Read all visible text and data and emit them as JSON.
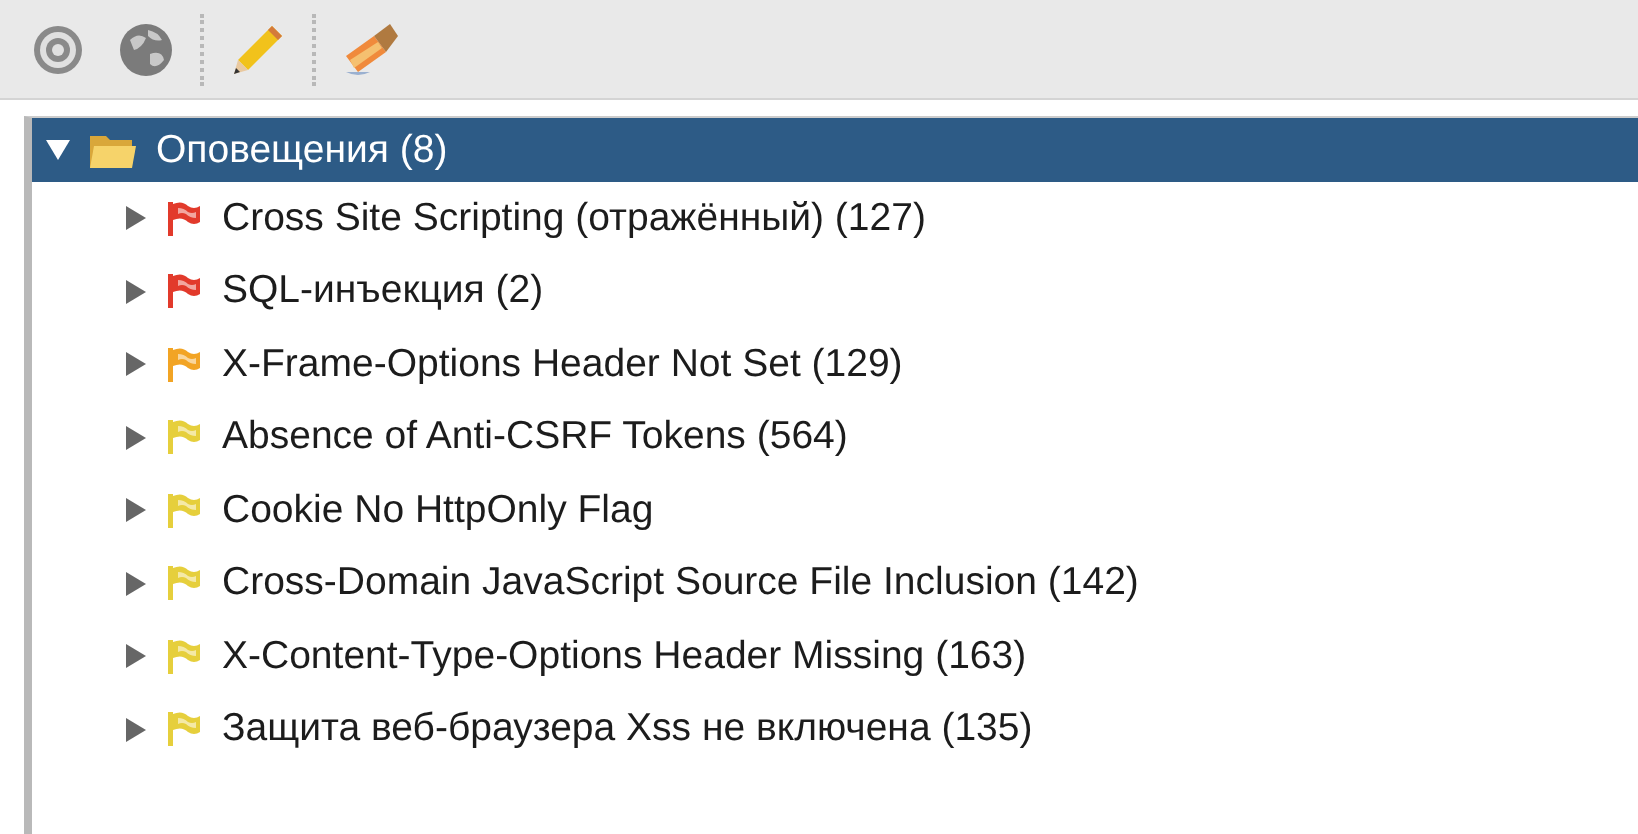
{
  "tree": {
    "label": "Оповещения (8)",
    "expanded": true,
    "selected": true,
    "children": [
      {
        "label": "Cross Site Scripting (отражённый) (127)",
        "expanded": false,
        "selected": false,
        "color": "#e23a2b"
      },
      {
        "label": "SQL-инъекция (2)",
        "expanded": false,
        "selected": false,
        "color": "#e23a2b"
      },
      {
        "label": "X-Frame-Options Header Not Set (129)",
        "expanded": false,
        "selected": false,
        "color": "#f2a424"
      },
      {
        "label": "Absence of Anti-CSRF Tokens (564)",
        "expanded": false,
        "selected": false,
        "color": "#e6cf3c"
      },
      {
        "label": "Cookie No HttpOnly Flag",
        "expanded": false,
        "selected": false,
        "color": "#e6cf3c"
      },
      {
        "label": "Cross-Domain JavaScript Source File Inclusion (142)",
        "expanded": false,
        "selected": false,
        "color": "#e6cf3c"
      },
      {
        "label": "X-Content-Type-Options Header Missing (163)",
        "expanded": false,
        "selected": false,
        "color": "#e6cf3c"
      },
      {
        "label": "Защита веб-браузера Xss не включена (135)",
        "expanded": false,
        "selected": false,
        "color": "#e6cf3c"
      }
    ]
  }
}
